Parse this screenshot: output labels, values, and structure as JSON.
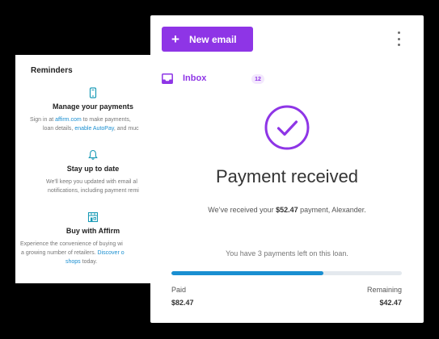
{
  "reminders": {
    "heading": "Reminders",
    "items": [
      {
        "icon": "phone-icon",
        "title": "Manage your payments",
        "body_line1_pre": "Sign in at ",
        "body_line1_link": "affirm.com",
        "body_line1_post": " to make payments,",
        "body_line2_pre": "loan details, ",
        "body_line2_link": "enable AutoPay",
        "body_line2_post": ", and muc"
      },
      {
        "icon": "bell-icon",
        "title": "Stay up to date",
        "body_line1": "We'll keep you updated with email al",
        "body_line2": "notifications, including payment remi"
      },
      {
        "icon": "storefront-icon",
        "title": "Buy with Affirm",
        "body_line1": "Experience the convenience of buying wi",
        "body_line2_pre": "a growing number of retailers. ",
        "body_line2_link": "Discover o",
        "body_line3_link": "shops",
        "body_line3_post": " today."
      }
    ]
  },
  "toolbar": {
    "new_email_label": "New email",
    "more_icon": "kebab-menu-icon"
  },
  "inbox": {
    "label": "Inbox",
    "count": "12"
  },
  "payment": {
    "title": "Payment received",
    "sub_pre": "We’ve received your ",
    "amount": "$52.47",
    "sub_post": " payment, Alexander.",
    "payments_left": "You have 3 payments left on this loan.",
    "progress_fraction": 0.66,
    "paid_label": "Paid",
    "paid_value": "$82.47",
    "remaining_label": "Remaining",
    "remaining_value": "$42.47"
  },
  "colors": {
    "accent": "#8e35e6",
    "progress": "#1a8fd1",
    "link": "#1a8fd1",
    "background": "#000000"
  }
}
